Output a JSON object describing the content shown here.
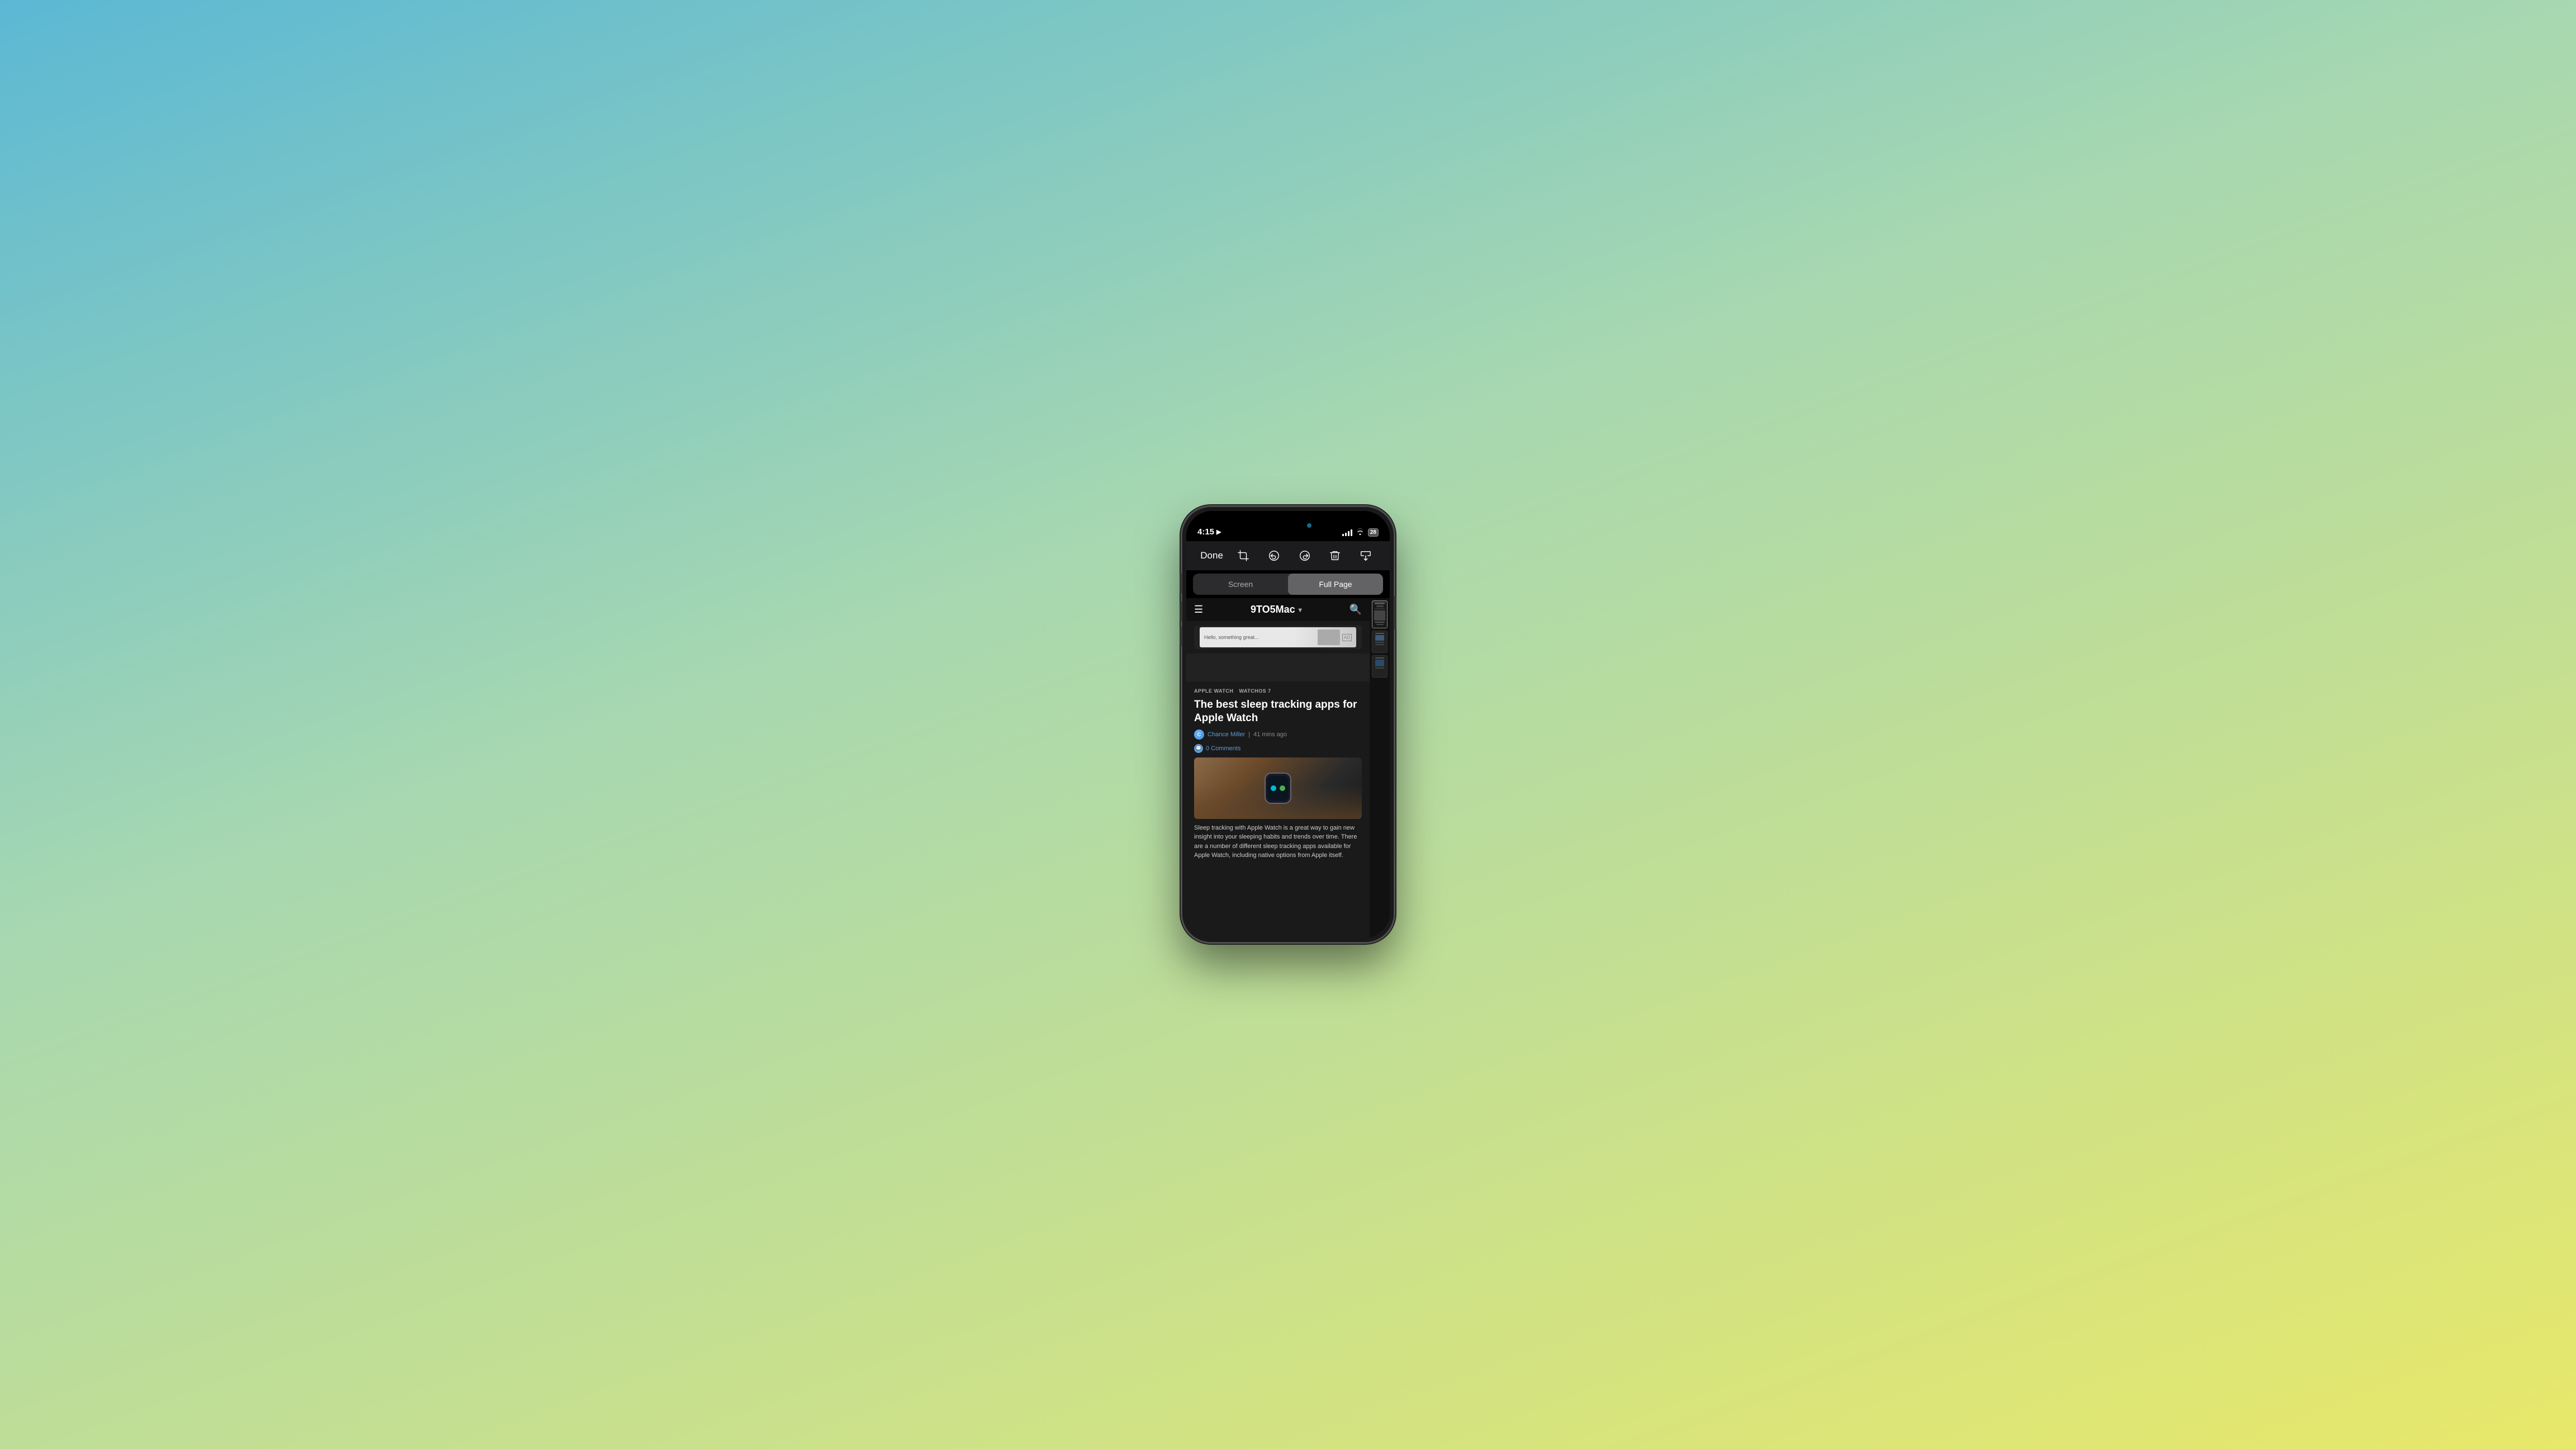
{
  "background": {
    "gradient": "linear-gradient(160deg, #5bb8d4 0%, #a8d8b0 40%, #e8e86a 100%)"
  },
  "status_bar": {
    "time": "4:15",
    "time_arrow": "➤",
    "battery": "28"
  },
  "toolbar": {
    "done_label": "Done",
    "crop_icon": "crop",
    "undo_icon": "undo",
    "redo_icon": "redo",
    "trash_icon": "trash",
    "share_icon": "share"
  },
  "tabs": {
    "screen_label": "Screen",
    "full_page_label": "Full Page",
    "active": "full_page"
  },
  "webpage": {
    "site_name": "9TO5Mac",
    "site_chevron": "▾",
    "ad_text": "Hello, something great...",
    "article": {
      "tag1": "APPLE WATCH",
      "tag2": "WATCHOS 7",
      "title": "The best sleep tracking apps for Apple Watch",
      "author": "Chance Miller",
      "time_ago": "41 mins ago",
      "comments": "0 Comments",
      "body_text": "Sleep tracking with Apple Watch is a great way to gain new insight into your sleeping habits and trends over time. There are a number of different sleep tracking apps available for Apple Watch, including native options from Apple itself."
    }
  }
}
